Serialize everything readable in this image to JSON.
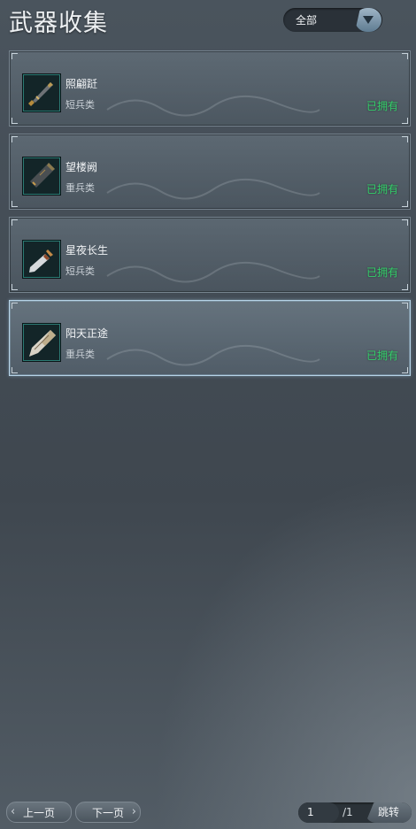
{
  "header": {
    "title": "武器收集"
  },
  "filter": {
    "selected": "全部"
  },
  "weapons": [
    {
      "name": "照翩跹",
      "category": "短兵类",
      "status": "已拥有"
    },
    {
      "name": "望楼阙",
      "category": "重兵类",
      "status": "已拥有"
    },
    {
      "name": "星夜长生",
      "category": "短兵类",
      "status": "已拥有"
    },
    {
      "name": "阳天正途",
      "category": "重兵类",
      "status": "已拥有"
    }
  ],
  "pagination": {
    "prev_label": "上一页",
    "next_label": "下一页",
    "current_page": "1",
    "total_pages": "/1",
    "jump_label": "跳转"
  },
  "colors": {
    "owned": "#34d06a",
    "icon_border": "#2b7a73"
  }
}
